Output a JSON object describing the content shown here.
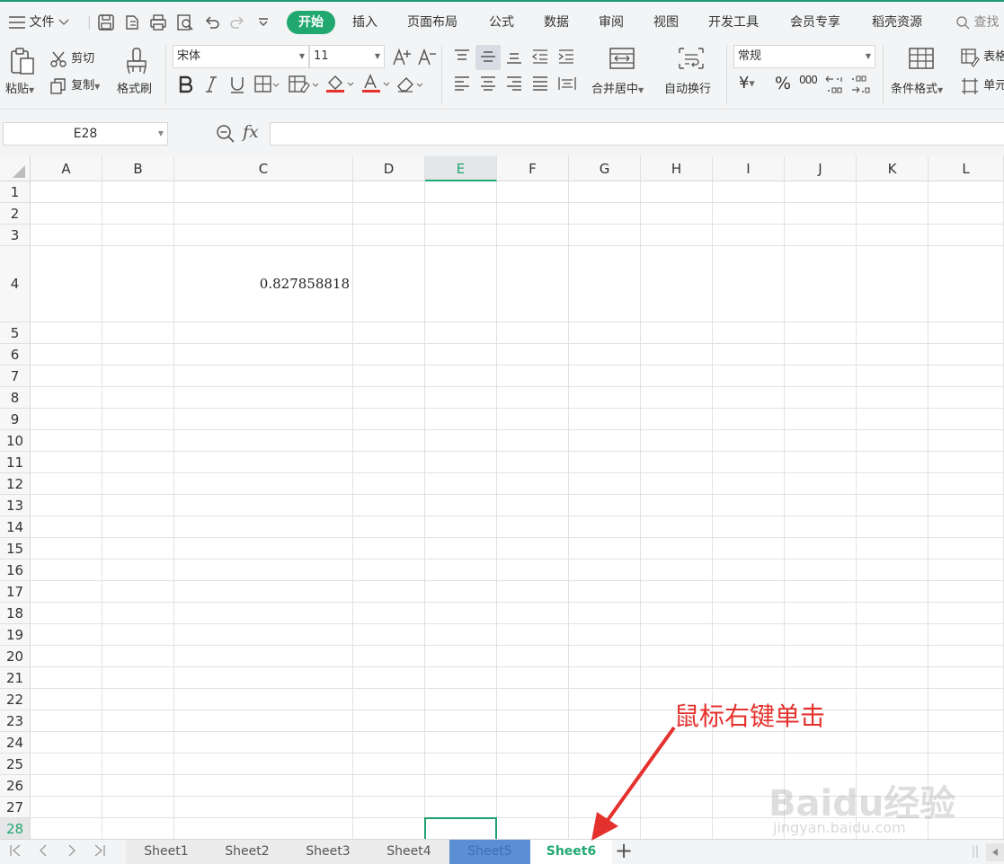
{
  "menubar": {
    "file_label": "文件",
    "tabs": [
      "开始",
      "插入",
      "页面布局",
      "公式",
      "数据",
      "审阅",
      "视图",
      "开发工具",
      "会员专享",
      "稻壳资源"
    ],
    "search_label": "查找"
  },
  "ribbon": {
    "paste_label": "粘贴",
    "cut_label": "剪切",
    "copy_label": "复制",
    "format_painter_label": "格式刷",
    "font_name": "宋体",
    "font_size": "11",
    "merge_label": "合并居中",
    "wrap_label": "自动换行",
    "number_format": "常规",
    "conditional_format_label": "条件格式",
    "table_style_label": "表格",
    "cell_label": "单元",
    "percent_glyph": "%",
    "thousands_glyph": "000",
    "currency_glyph": "¥"
  },
  "formula_bar": {
    "name_box": "E28",
    "fx_label": "fx",
    "formula": ""
  },
  "grid": {
    "columns": [
      "A",
      "B",
      "C",
      "D",
      "E",
      "F",
      "G",
      "H",
      "I",
      "J",
      "K",
      "L"
    ],
    "active_column": "E",
    "rows": [
      "1",
      "2",
      "3",
      "4",
      "5",
      "6",
      "7",
      "8",
      "9",
      "10",
      "11",
      "12",
      "13",
      "14",
      "15",
      "16",
      "17",
      "18",
      "19",
      "20",
      "21",
      "22",
      "23",
      "24",
      "25",
      "26",
      "27",
      "28"
    ],
    "active_row": "28",
    "cell_C4": "0.827858818"
  },
  "sheet_tabs": {
    "tabs": [
      "Sheet1",
      "Sheet2",
      "Sheet3",
      "Sheet4",
      "Sheet5",
      "Sheet6"
    ],
    "active": "Sheet6",
    "add_label": "+"
  },
  "annotation": {
    "text": "鼠标右键单击"
  },
  "watermark": {
    "brand": "Baidu经验",
    "url": "jingyan.baidu.com"
  },
  "colors": {
    "accent": "#21a870",
    "annotation": "#e5312d",
    "sheet5_selected": "#5b8fd4"
  }
}
